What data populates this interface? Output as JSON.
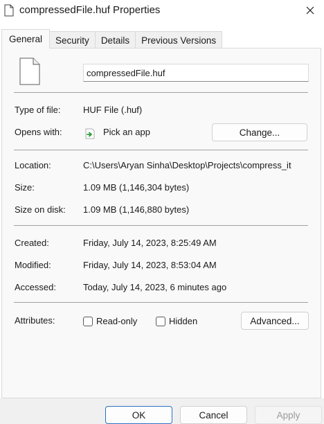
{
  "window": {
    "title": "compressedFile.huf Properties"
  },
  "tabs": [
    {
      "label": "General",
      "active": true
    },
    {
      "label": "Security",
      "active": false
    },
    {
      "label": "Details",
      "active": false
    },
    {
      "label": "Previous Versions",
      "active": false
    }
  ],
  "general": {
    "file_name": "compressedFile.huf",
    "type_label": "Type of file:",
    "type_value": "HUF File (.huf)",
    "opens_label": "Opens with:",
    "opens_value": "Pick an app",
    "change_button": "Change...",
    "location_label": "Location:",
    "location_value": "C:\\Users\\Aryan Sinha\\Desktop\\Projects\\compress_it",
    "size_label": "Size:",
    "size_value": "1.09 MB (1,146,304 bytes)",
    "size_on_disk_label": "Size on disk:",
    "size_on_disk_value": "1.09 MB (1,146,880 bytes)",
    "created_label": "Created:",
    "created_value": "Friday, July 14, 2023, 8:25:49 AM",
    "modified_label": "Modified:",
    "modified_value": "Friday, July 14, 2023, 8:53:04 AM",
    "accessed_label": "Accessed:",
    "accessed_value": "Today, July 14, 2023, 6 minutes ago",
    "attributes_label": "Attributes:",
    "readonly_label": "Read-only",
    "readonly_checked": false,
    "hidden_label": "Hidden",
    "hidden_checked": false,
    "advanced_button": "Advanced..."
  },
  "footer": {
    "ok_label": "OK",
    "cancel_label": "Cancel",
    "apply_label": "Apply"
  },
  "icons": {
    "title": "file-icon",
    "close": "close-icon",
    "file_large": "file-icon",
    "pick_app": "pick-app-icon"
  },
  "colors": {
    "panel_bg": "#f9f9f9",
    "accent_border": "#2a6fc0",
    "app_icon_green": "#2e9e3a"
  }
}
